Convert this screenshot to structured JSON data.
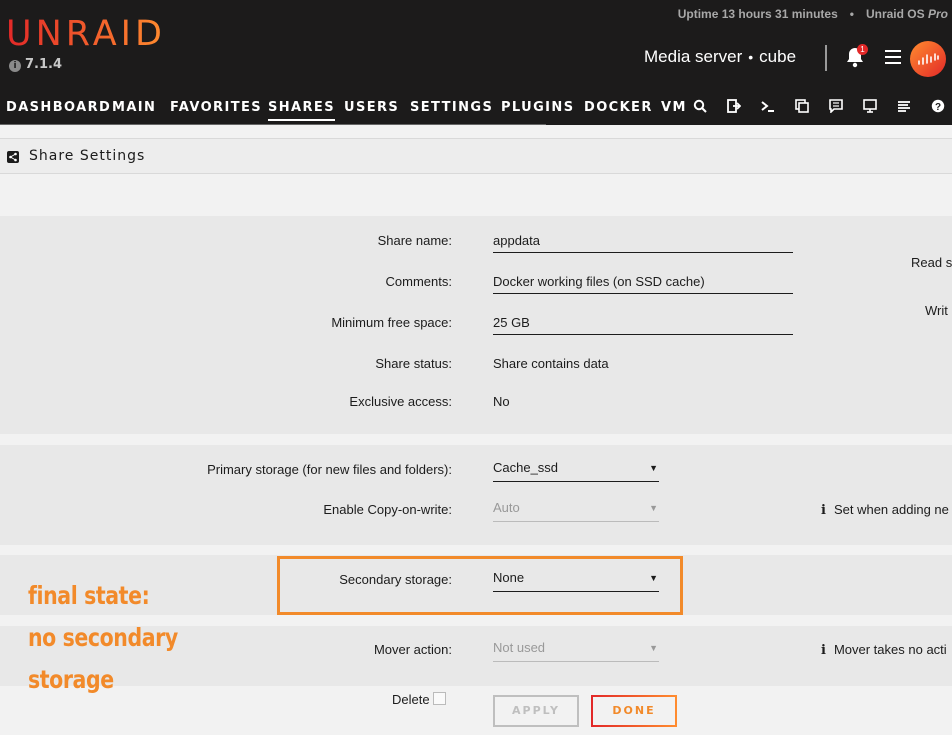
{
  "header": {
    "logo": "UNRAID",
    "version": "7.1.4",
    "uptime": "Uptime 13 hours 31 minutes",
    "os_label_prefix": "Unraid OS",
    "os_label_edition": "Pro",
    "server_name": "Media server",
    "server_desc": "cube",
    "notification_count": "1"
  },
  "nav": {
    "items": [
      {
        "label": "DASHBOARD"
      },
      {
        "label": "MAIN"
      },
      {
        "label": "FAVORITES"
      },
      {
        "label": "SHARES",
        "active": true
      },
      {
        "label": "USERS"
      },
      {
        "label": "SETTINGS"
      },
      {
        "label": "PLUGINS"
      },
      {
        "label": "DOCKER"
      },
      {
        "label": "VMS"
      }
    ],
    "icons": [
      "search-icon",
      "logout-icon",
      "terminal-icon",
      "copy-icon",
      "feedback-icon",
      "monitor-icon",
      "log-icon",
      "help-icon"
    ]
  },
  "section": {
    "title": "Share Settings"
  },
  "form": {
    "share_name_label": "Share name:",
    "share_name_value": "appdata",
    "comments_label": "Comments:",
    "comments_value": "Docker working files (on SSD cache)",
    "min_free_label": "Minimum free space:",
    "min_free_value": "25 GB",
    "status_label": "Share status:",
    "status_value": "Share contains data",
    "exclusive_label": "Exclusive access:",
    "exclusive_value": "No",
    "primary_label": "Primary storage (for new files and folders):",
    "primary_value": "Cache_ssd",
    "cow_label": "Enable Copy-on-write:",
    "cow_value": "Auto",
    "cow_note": "Set when adding ne",
    "secondary_label": "Secondary storage:",
    "secondary_value": "None",
    "mover_label": "Mover action:",
    "mover_value": "Not used",
    "mover_note": "Mover takes no acti",
    "read_cut": "Read s",
    "write_cut": "Writ",
    "delete_label": "Delete"
  },
  "buttons": {
    "apply": "APPLY",
    "done": "DONE"
  },
  "annotation": {
    "line1": "final state:",
    "line2": "no secondary",
    "line3": "storage",
    "color": "#f28a2a"
  }
}
